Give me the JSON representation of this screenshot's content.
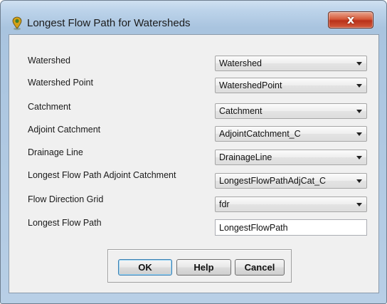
{
  "window": {
    "title": "Longest Flow Path for Watersheds",
    "icon": "map-pin-icon",
    "close_glyph": "x"
  },
  "fields": [
    {
      "label": "Watershed",
      "type": "select",
      "value": "Watershed"
    },
    {
      "label": "Watershed Point",
      "type": "select",
      "value": "WatershedPoint"
    },
    {
      "label": "Catchment",
      "type": "select",
      "value": "Catchment"
    },
    {
      "label": "Adjoint Catchment",
      "type": "select",
      "value": "AdjointCatchment_C"
    },
    {
      "label": "Drainage Line",
      "type": "select",
      "value": "DrainageLine"
    },
    {
      "label": "Longest Flow Path Adjoint Catchment",
      "type": "select",
      "value": "LongestFlowPathAdjCat_C"
    },
    {
      "label": "Flow Direction Grid",
      "type": "select",
      "value": "fdr"
    },
    {
      "label": "Longest Flow Path",
      "type": "text",
      "value": "LongestFlowPath"
    }
  ],
  "buttons": {
    "ok": "OK",
    "help": "Help",
    "cancel": "Cancel"
  },
  "colors": {
    "titlebar": "#bcd3ea",
    "close_button": "#c7432a",
    "dialog_background": "#f0f0f0"
  }
}
